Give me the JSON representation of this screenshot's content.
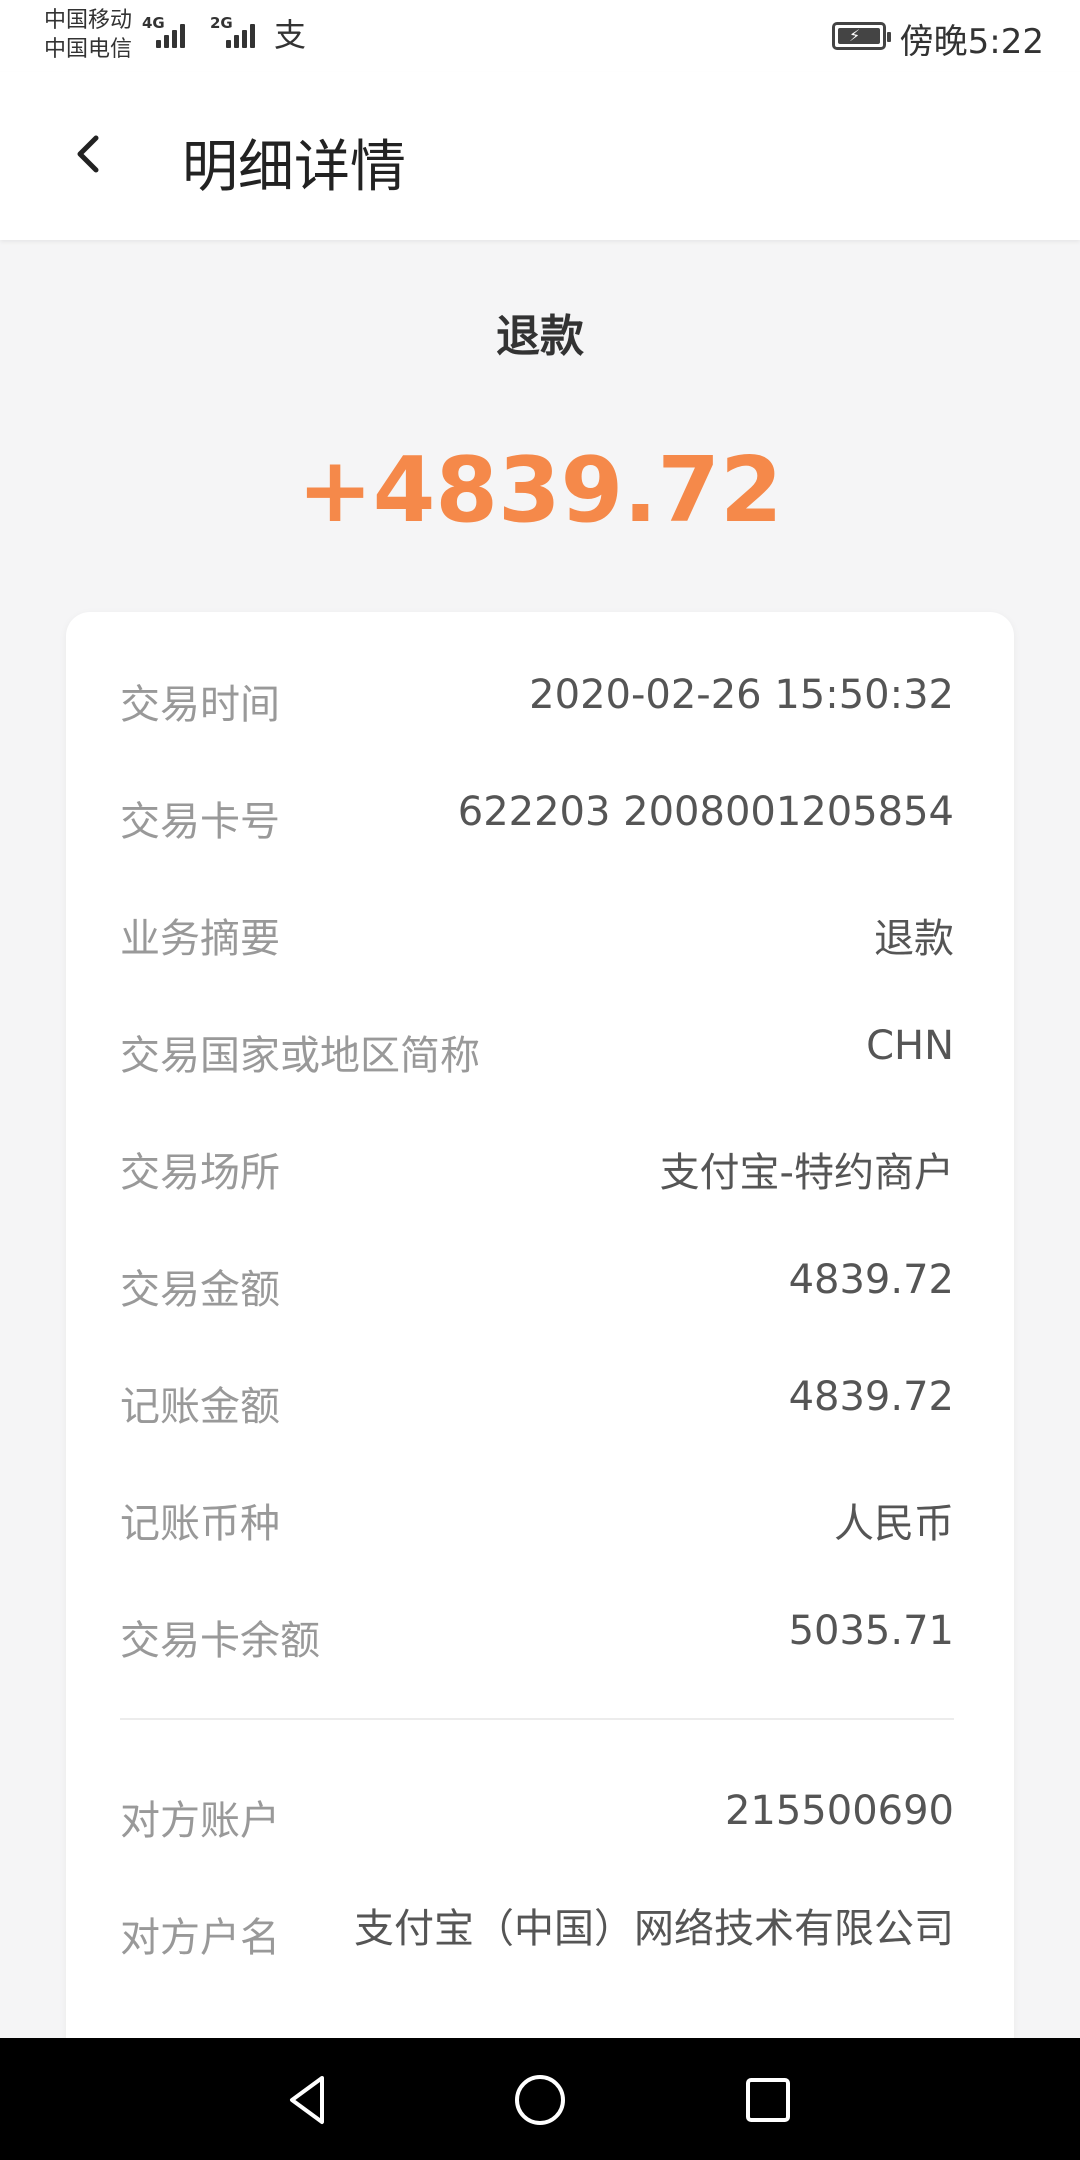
{
  "status_bar": {
    "carrier1": "中国移动",
    "carrier2": "中国电信",
    "net1": "4G",
    "net2": "2G",
    "time": "傍晚5:22"
  },
  "header": {
    "title": "明细详情"
  },
  "transaction": {
    "type": "退款",
    "amount": "+4839.72"
  },
  "details": [
    {
      "label": "交易时间",
      "value": "2020-02-26 15:50:32"
    },
    {
      "label": "交易卡号",
      "value": "622203 2008001205854"
    },
    {
      "label": "业务摘要",
      "value": "退款"
    },
    {
      "label": "交易国家或地区简称",
      "value": "CHN"
    },
    {
      "label": "交易场所",
      "value": "支付宝-特约商户"
    },
    {
      "label": "交易金额",
      "value": "4839.72"
    },
    {
      "label": "记账金额",
      "value": "4839.72"
    },
    {
      "label": "记账币种",
      "value": "人民币"
    },
    {
      "label": "交易卡余额",
      "value": "5035.71"
    }
  ],
  "counterparty": [
    {
      "label": "对方账户",
      "value": "215500690"
    },
    {
      "label": "对方户名",
      "value": "支付宝（中国）网络技术有限公司"
    }
  ],
  "colors": {
    "amount": "#f5894a",
    "background": "#f5f5f6"
  }
}
